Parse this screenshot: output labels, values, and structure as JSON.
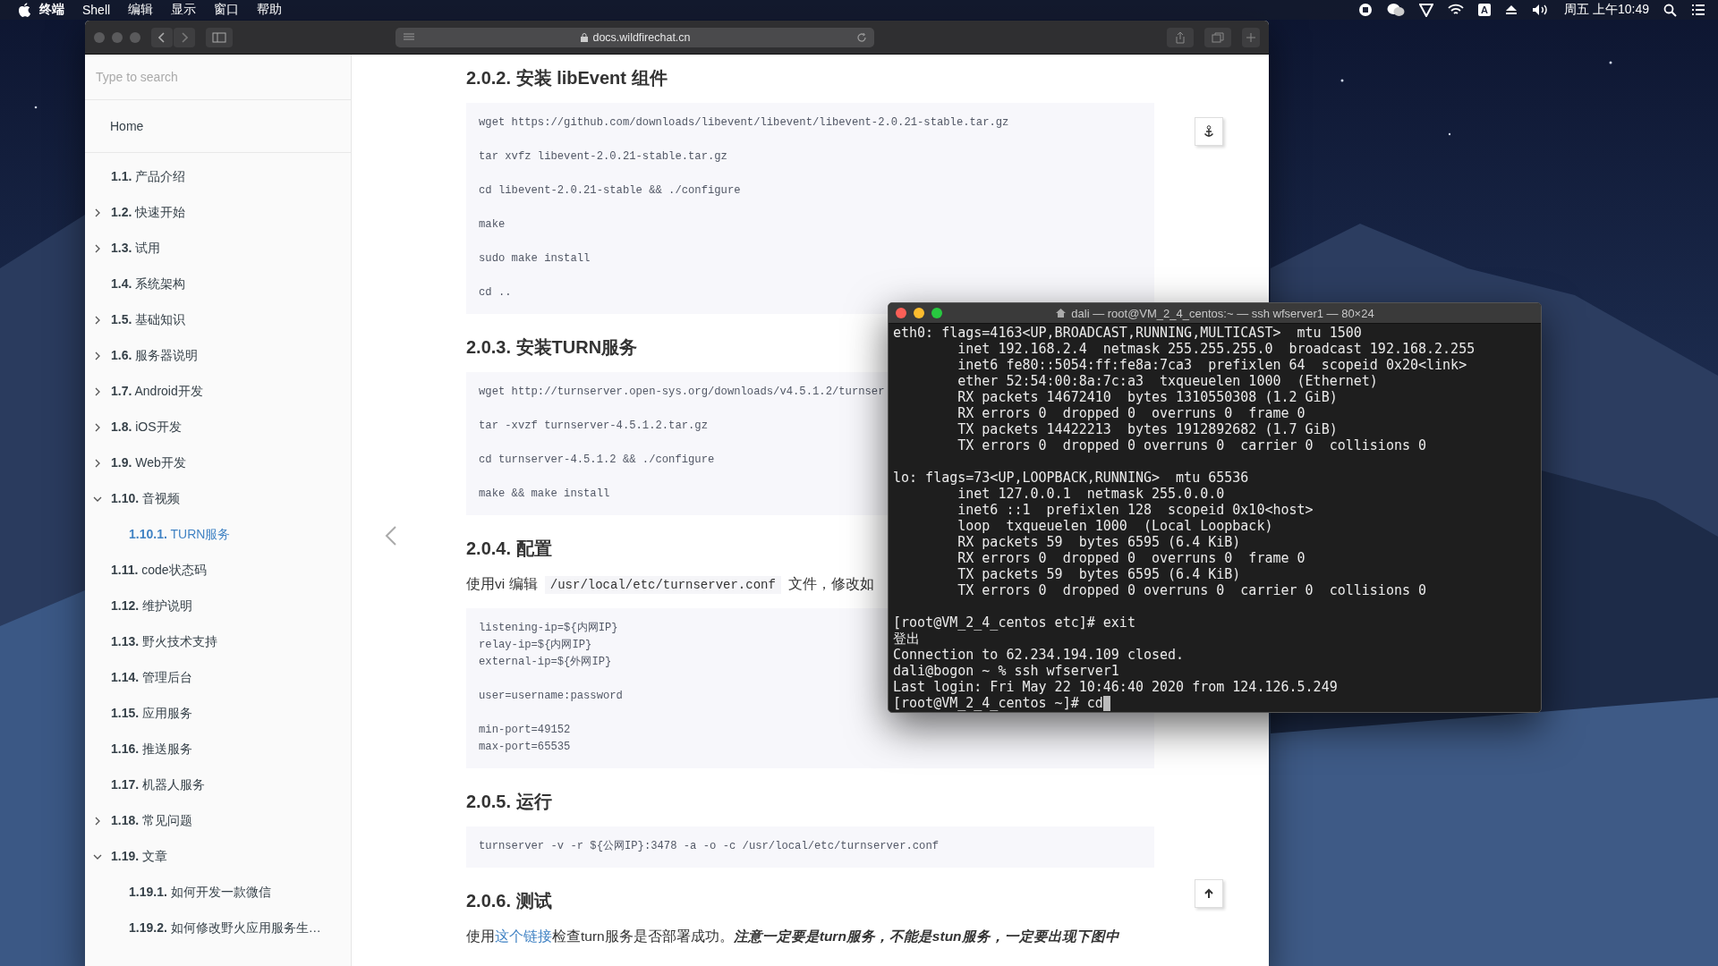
{
  "menubar": {
    "app": "终端",
    "menus": [
      "Shell",
      "编辑",
      "显示",
      "窗口",
      "帮助"
    ],
    "input_source": "A",
    "clock": "周五 上午10:49"
  },
  "browser": {
    "url": "docs.wildfirechat.cn",
    "sidebar": {
      "search": {
        "placeholder": "Type to search"
      },
      "home": {
        "label": "Home",
        "selected": false
      },
      "items": [
        {
          "number": "1.1.",
          "title": "产品介绍",
          "selected": false
        },
        {
          "number": "1.2.",
          "title": "快速开始",
          "selected": false,
          "expanded": false
        },
        {
          "number": "1.3.",
          "title": "试用",
          "selected": false,
          "expanded": false
        },
        {
          "number": "1.4.",
          "title": "系统架构",
          "selected": false
        },
        {
          "number": "1.5.",
          "title": "基础知识",
          "selected": false,
          "expanded": false
        },
        {
          "number": "1.6.",
          "title": "服务器说明",
          "selected": false,
          "expanded": false
        },
        {
          "number": "1.7.",
          "title": "Android开发",
          "selected": false,
          "expanded": false
        },
        {
          "number": "1.8.",
          "title": "iOS开发",
          "selected": false,
          "expanded": false
        },
        {
          "number": "1.9.",
          "title": "Web开发",
          "selected": false,
          "expanded": false
        },
        {
          "number": "1.10.",
          "title": "音视频",
          "selected": false,
          "expanded": true,
          "children": [
            {
              "number": "1.10.1.",
              "title": "TURN服务",
              "selected": true
            }
          ]
        },
        {
          "number": "1.11.",
          "title": "code状态码",
          "selected": false
        },
        {
          "number": "1.12.",
          "title": "维护说明",
          "selected": false
        },
        {
          "number": "1.13.",
          "title": "野火技术支持",
          "selected": false
        },
        {
          "number": "1.14.",
          "title": "管理后台",
          "selected": false
        },
        {
          "number": "1.15.",
          "title": "应用服务",
          "selected": false
        },
        {
          "number": "1.16.",
          "title": "推送服务",
          "selected": false
        },
        {
          "number": "1.17.",
          "title": "机器人服务",
          "selected": false
        },
        {
          "number": "1.18.",
          "title": "常见问题",
          "selected": false,
          "expanded": false
        },
        {
          "number": "1.19.",
          "title": "文章",
          "selected": false,
          "expanded": true,
          "children": [
            {
              "number": "1.19.1.",
              "title": "如何开发一款微信",
              "selected": false
            },
            {
              "number": "1.19.2.",
              "title": "如何修改野火应用服务生…",
              "selected": false
            }
          ]
        }
      ]
    },
    "content": [
      {
        "kind": "heading",
        "text": "2.0.2. 安装 libEvent 组件"
      },
      {
        "kind": "code",
        "groups": [
          [
            "wget https://github.com/downloads/libevent/libevent/libevent-2.0.21-stable.tar.gz"
          ],
          [
            "tar xvfz libevent-2.0.21-stable.tar.gz"
          ],
          [
            "cd libevent-2.0.21-stable && ./configure"
          ],
          [
            "make"
          ],
          [
            "sudo make install"
          ],
          [
            "cd .."
          ]
        ]
      },
      {
        "kind": "heading",
        "text": "2.0.3. 安装TURN服务"
      },
      {
        "kind": "code",
        "groups": [
          [
            "wget http://turnserver.open-sys.org/downloads/v4.5.1.2/turnser"
          ],
          [
            "tar -xvzf turnserver-4.5.1.2.tar.gz"
          ],
          [
            "cd turnserver-4.5.1.2 && ./configure"
          ],
          [
            "make && make install"
          ]
        ]
      },
      {
        "kind": "heading",
        "text": "2.0.4. 配置"
      },
      {
        "kind": "paragraph",
        "parts": [
          {
            "kind": "text",
            "text": "使用vi 编辑 "
          },
          {
            "kind": "code",
            "text": "/usr/local/etc/turnserver.conf"
          },
          {
            "kind": "text",
            "text": " 文件，修改如"
          }
        ]
      },
      {
        "kind": "code",
        "groups": [
          [
            "listening-ip=${内网IP}",
            "relay-ip=${内网IP}",
            "external-ip=${外网IP}"
          ],
          [
            "user=username:password"
          ],
          [
            "min-port=49152",
            "max-port=65535"
          ]
        ]
      },
      {
        "kind": "heading",
        "text": "2.0.5. 运行"
      },
      {
        "kind": "code",
        "groups": [
          [
            "turnserver -v -r ${公网IP}:3478 -a -o -c /usr/local/etc/turnserver.conf"
          ]
        ]
      },
      {
        "kind": "heading",
        "text": "2.0.6. 测试"
      },
      {
        "kind": "paragraph",
        "parts": [
          {
            "kind": "text",
            "text": "使用"
          },
          {
            "kind": "link",
            "text": "这个链接"
          },
          {
            "kind": "text",
            "text": "检查turn服务是否部署成功。"
          },
          {
            "kind": "emphasis",
            "text": "注意一定要是turn服务，不能是stun服务，一定要出现下图中"
          }
        ]
      }
    ]
  },
  "terminal": {
    "title": "dali — root@VM_2_4_centos:~ — ssh wfserver1 — 80×24",
    "active": true,
    "blocks": [
      [
        "eth0: flags=4163<UP,BROADCAST,RUNNING,MULTICAST>  mtu 1500",
        "        inet 192.168.2.4  netmask 255.255.255.0  broadcast 192.168.2.255",
        "        inet6 fe80::5054:ff:fe8a:7ca3  prefixlen 64  scopeid 0x20<link>",
        "        ether 52:54:00:8a:7c:a3  txqueuelen 1000  (Ethernet)",
        "        RX packets 14672410  bytes 1310550308 (1.2 GiB)",
        "        RX errors 0  dropped 0  overruns 0  frame 0",
        "        TX packets 14422213  bytes 1912892682 (1.7 GiB)",
        "        TX errors 0  dropped 0 overruns 0  carrier 0  collisions 0"
      ],
      [
        "lo: flags=73<UP,LOOPBACK,RUNNING>  mtu 65536",
        "        inet 127.0.0.1  netmask 255.0.0.0",
        "        inet6 ::1  prefixlen 128  scopeid 0x10<host>",
        "        loop  txqueuelen 1000  (Local Loopback)",
        "        RX packets 59  bytes 6595 (6.4 KiB)",
        "        RX errors 0  dropped 0  overruns 0  frame 0",
        "        TX packets 59  bytes 6595 (6.4 KiB)",
        "        TX errors 0  dropped 0 overruns 0  carrier 0  collisions 0"
      ],
      [
        "[root@VM_2_4_centos etc]# exit",
        "登出",
        "Connection to 62.234.194.109 closed.",
        "dali@bogon ~ % ssh wfserver1",
        "Last login: Fri May 22 10:46:40 2020 from 124.126.5.249",
        "[root@VM_2_4_centos ~]# cd"
      ]
    ]
  }
}
